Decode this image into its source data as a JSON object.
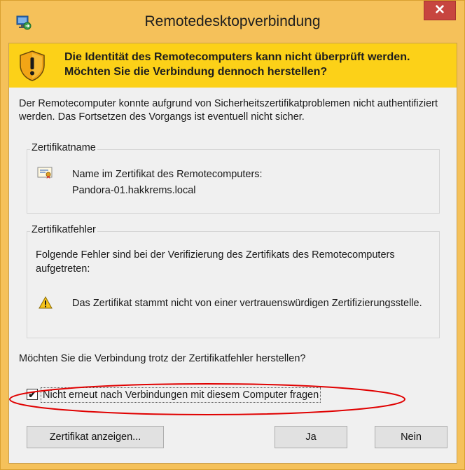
{
  "window": {
    "title": "Remotedesktopverbindung",
    "close_glyph": "✕"
  },
  "banner": {
    "text": "Die Identität des Remotecomputers kann nicht überprüft werden. Möchten Sie die Verbindung dennoch herstellen?"
  },
  "intro": "Der Remotecomputer konnte aufgrund von Sicherheitszertifikatproblemen nicht authentifiziert werden. Das Fortsetzen des Vorgangs ist eventuell nicht sicher.",
  "cert_group": {
    "label": "Zertifikatname",
    "field_label": "Name im Zertifikat des Remotecomputers:",
    "field_value": "Pandora-01.hakkrems.local"
  },
  "error_group": {
    "label": "Zertifikatfehler",
    "intro": "Folgende Fehler sind bei der Verifizierung des Zertifikats des Remotecomputers aufgetreten:",
    "error": "Das Zertifikat stammt nicht von einer vertrauenswürdigen Zertifizierungsstelle."
  },
  "question": "Möchten Sie die Verbindung trotz der Zertifikatfehler herstellen?",
  "checkbox": {
    "label": "Nicht erneut nach Verbindungen mit diesem Computer fragen",
    "checked": true,
    "check_glyph": "✔"
  },
  "buttons": {
    "view_cert": "Zertifikat anzeigen...",
    "yes": "Ja",
    "no": "Nein"
  },
  "colors": {
    "titlebar": "#f5c15a",
    "banner": "#fcd118",
    "close": "#c7453f",
    "annotation": "#e00000"
  },
  "icons": [
    "app-icon",
    "shield-warning-icon",
    "certificate-icon",
    "warning-icon",
    "close-icon"
  ]
}
